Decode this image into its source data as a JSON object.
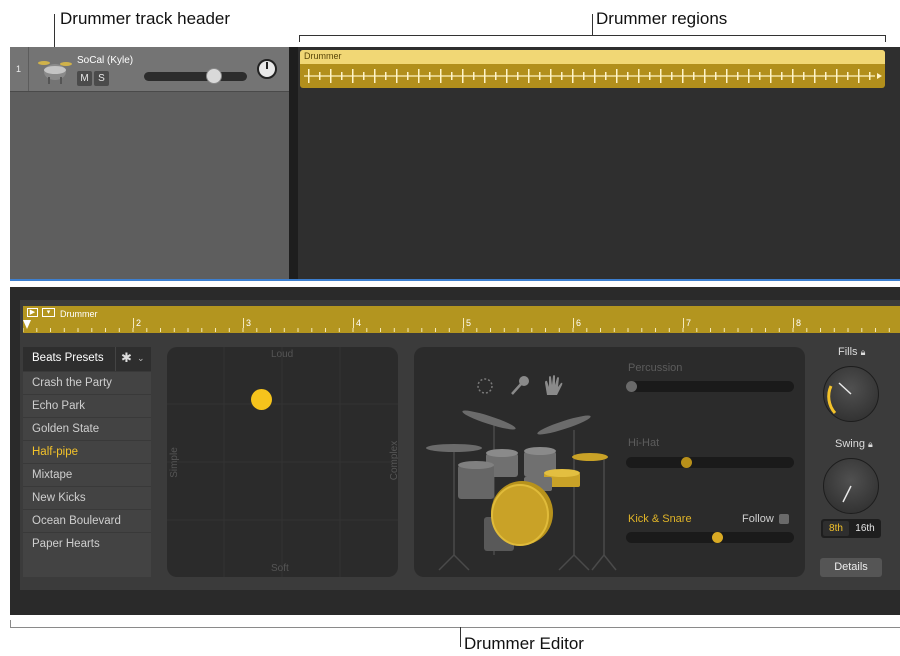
{
  "callouts": {
    "track_header": "Drummer track header",
    "regions": "Drummer regions",
    "editor": "Drummer Editor"
  },
  "track": {
    "number": "1",
    "name": "SoCal (Kyle)",
    "mute": "M",
    "solo": "S",
    "volume_level": 0.71
  },
  "region": {
    "name": "Drummer"
  },
  "editor": {
    "ruler_title": "Drummer",
    "ruler_marks": [
      "2",
      "3",
      "4",
      "5",
      "6",
      "7",
      "8"
    ],
    "presets_header": "Beats Presets",
    "presets": [
      "Crash the Party",
      "Echo Park",
      "Golden State",
      "Half-pipe",
      "Mixtape",
      "New Kicks",
      "Ocean Boulevard",
      "Paper Hearts"
    ],
    "selected_preset": "Half-pipe",
    "pad": {
      "top": "Loud",
      "bottom": "Soft",
      "left": "Simple",
      "right": "Complex"
    },
    "instruments": {
      "percussion": "Percussion",
      "hihat": "Hi-Hat",
      "kick_snare": "Kick & Snare",
      "follow": "Follow",
      "percussion_level": 0.0,
      "hihat_level": 0.35,
      "kick_snare_level": 0.55
    },
    "fills_label": "Fills",
    "swing_label": "Swing",
    "swing_8th": "8th",
    "swing_16th": "16th",
    "details": "Details"
  },
  "colors": {
    "accent": "#f3c22a",
    "region": "#b28f1c"
  }
}
